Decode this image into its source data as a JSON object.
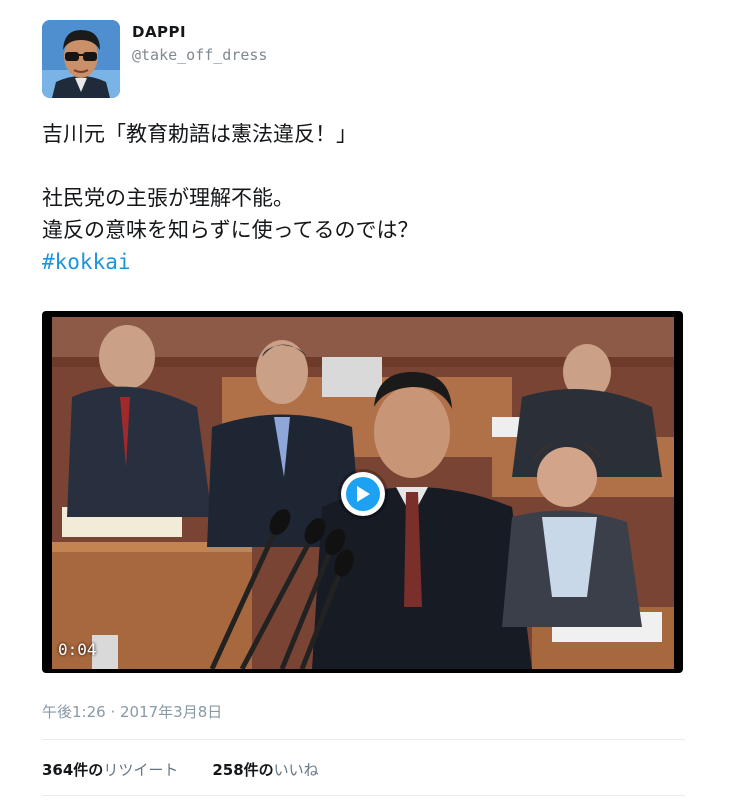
{
  "user": {
    "display_name": "DAPPI",
    "username": "@take_off_dress"
  },
  "tweet": {
    "lines": [
      "吉川元「教育勅語は憲法違反！」",
      "社民党の主張が理解不能。",
      "違反の意味を知らずに使ってるのでは？"
    ],
    "hashtag": "#kokkai"
  },
  "video": {
    "timestamp": "0:04"
  },
  "meta": {
    "time": "午後1:26 · 2017年3月8日"
  },
  "stats": {
    "retweets_count": "364件の",
    "retweets_label": "リツイート",
    "likes_count": "258件の",
    "likes_label": "いいね"
  },
  "colors": {
    "hashtag": "#1b95e0",
    "play_button": "#1da1f2",
    "muted_text": "#8899a6"
  }
}
